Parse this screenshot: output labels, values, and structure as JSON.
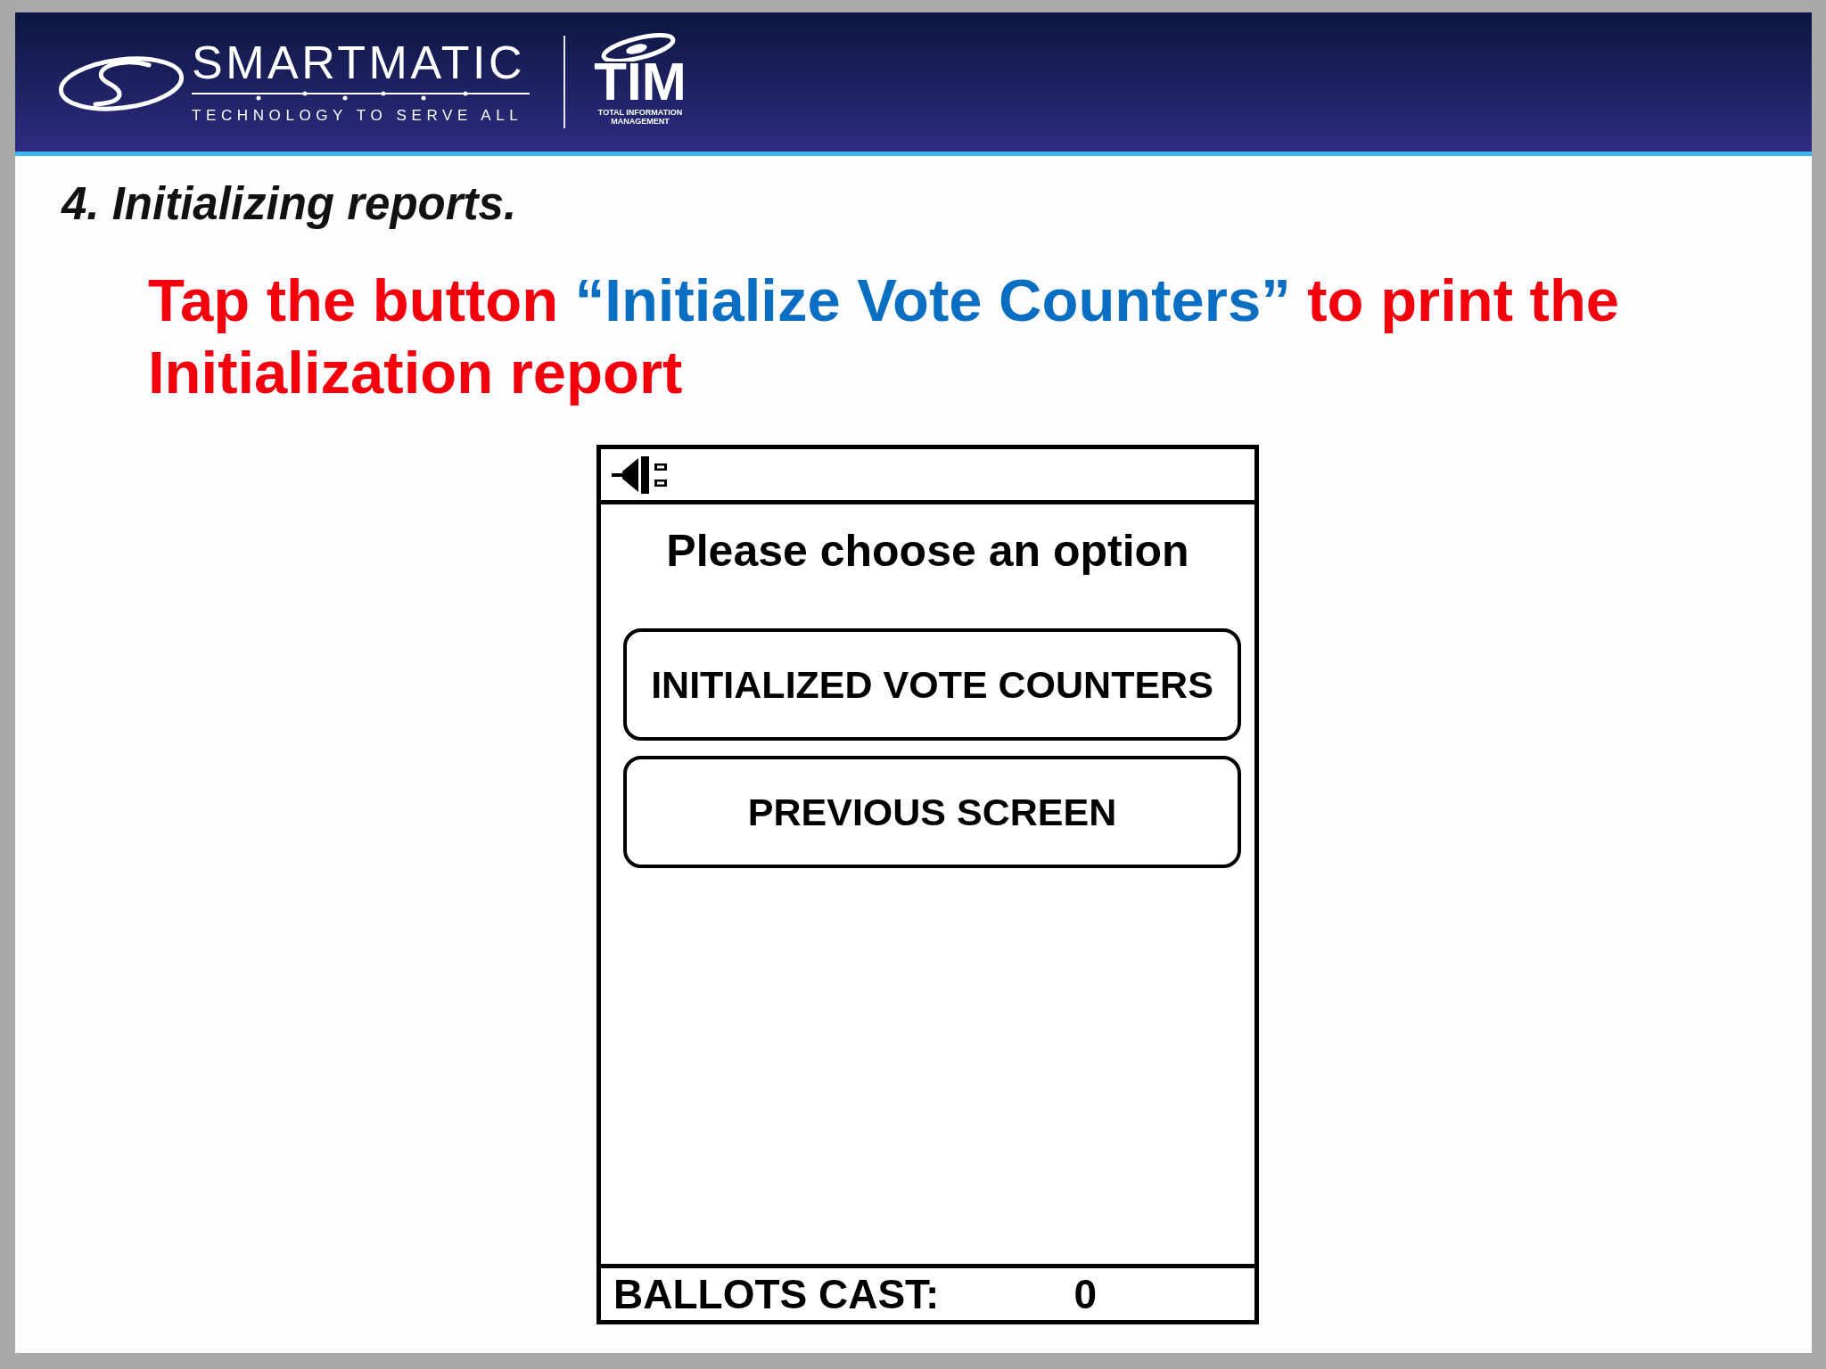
{
  "header": {
    "logo": {
      "wordmark": "SMARTMATIC",
      "tagline": "TECHNOLOGY TO SERVE ALL"
    },
    "partner_logo": {
      "wordmark": "TIM",
      "tagline": "TOTAL INFORMATION MANAGEMENT"
    }
  },
  "heading": "4. Initializing reports.",
  "instruction": [
    {
      "kind": "plain",
      "text": "Tap the button "
    },
    {
      "kind": "highlight",
      "text": "“Initialize Vote Counters”"
    },
    {
      "kind": "plain",
      "text": " to print the Initialization report"
    }
  ],
  "device_screen": {
    "prompt": "Please choose an option",
    "buttons": [
      "INITIALIZED VOTE COUNTERS",
      "PREVIOUS SCREEN"
    ],
    "footer": {
      "label": "BALLOTS CAST:",
      "value": "0"
    }
  }
}
